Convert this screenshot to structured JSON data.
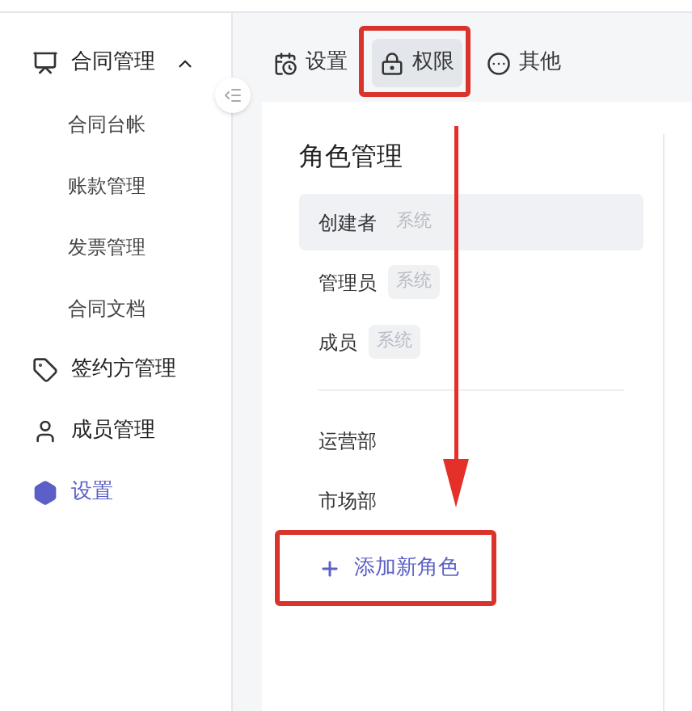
{
  "sidebar": {
    "items": [
      {
        "label": "合同管理",
        "expanded": true,
        "selected": false,
        "children": [
          {
            "label": "合同台帐",
            "selected": false
          },
          {
            "label": "账款管理",
            "selected": false
          },
          {
            "label": "发票管理",
            "selected": false
          },
          {
            "label": "合同文档",
            "selected": false
          }
        ]
      },
      {
        "label": "签约方管理",
        "selected": false
      },
      {
        "label": "成员管理",
        "selected": false
      },
      {
        "label": "设置",
        "selected": true
      }
    ]
  },
  "toolbar": {
    "tabs": [
      {
        "label": "设置",
        "selected": false
      },
      {
        "label": "权限",
        "selected": true
      },
      {
        "label": "其他",
        "selected": false
      }
    ]
  },
  "role_panel": {
    "title": "角色管理",
    "system_roles": [
      {
        "name": "创建者",
        "tag": "系统",
        "selected": true
      },
      {
        "name": "管理员",
        "tag": "系统",
        "selected": false
      },
      {
        "name": "成员",
        "tag": "系统",
        "selected": false
      }
    ],
    "custom_roles": [
      {
        "name": "运营部",
        "selected": false
      },
      {
        "name": "市场部",
        "selected": false
      }
    ],
    "add_button": "添加新角色"
  }
}
